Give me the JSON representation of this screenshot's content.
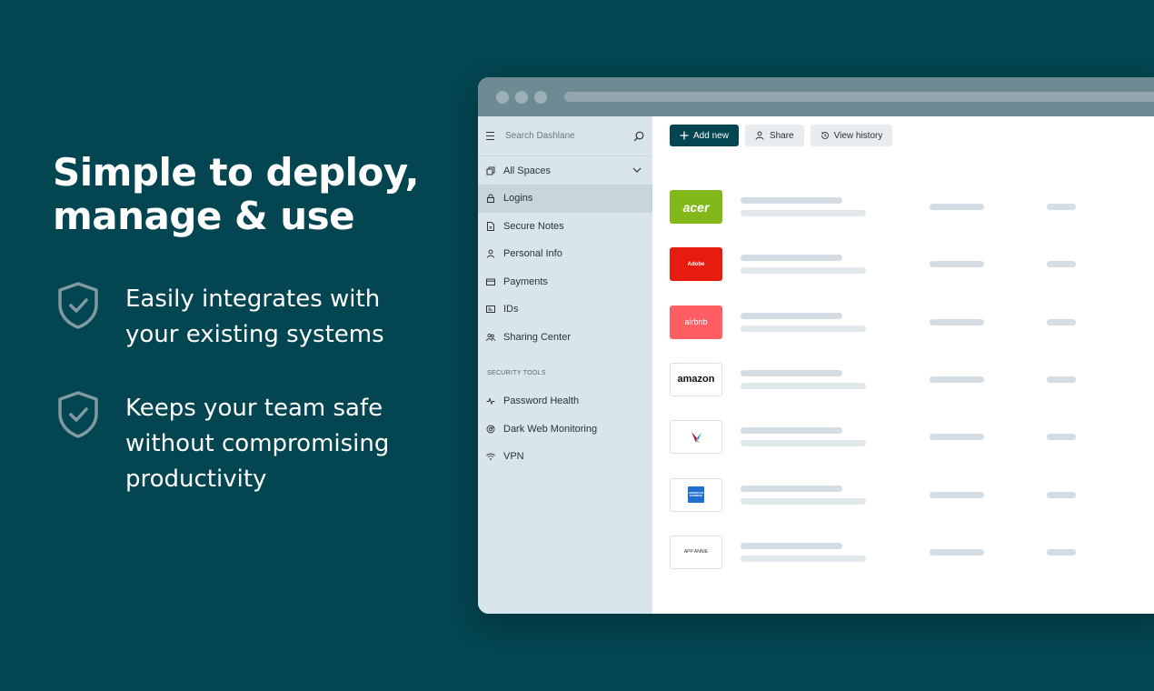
{
  "headline": "Simple to deploy, manage & use",
  "features": [
    {
      "text": "Easily integrates with your existing systems",
      "icon": "shield-check-icon"
    },
    {
      "text": "Keeps your team safe without compromising productivity",
      "icon": "shield-check-icon"
    }
  ],
  "app": {
    "search": {
      "placeholder": "Search Dashlane"
    },
    "spaces_label": "All Spaces",
    "nav": [
      {
        "label": "Logins",
        "icon": "lock-icon",
        "active": true
      },
      {
        "label": "Secure Notes",
        "icon": "note-icon"
      },
      {
        "label": "Personal Info",
        "icon": "person-icon"
      },
      {
        "label": "Payments",
        "icon": "card-icon"
      },
      {
        "label": "IDs",
        "icon": "id-icon"
      },
      {
        "label": "Sharing Center",
        "icon": "people-icon"
      }
    ],
    "security_tools_label": "SECURITY TOOLS",
    "tools": [
      {
        "label": "Password Health",
        "icon": "pulse-icon"
      },
      {
        "label": "Dark Web Monitoring",
        "icon": "radar-icon"
      },
      {
        "label": "VPN",
        "icon": "wifi-icon"
      }
    ],
    "toolbar": {
      "add_new": "Add new",
      "share": "Share",
      "view_history": "View history"
    },
    "logins": [
      {
        "brand": "acer",
        "logo_text": "acer",
        "bg": "#83b81a",
        "fg": "#ffffff"
      },
      {
        "brand": "adobe",
        "logo_text": "Adobe",
        "bg": "#e61c0f",
        "fg": "#ffffff"
      },
      {
        "brand": "airbnb",
        "logo_text": "airbnb",
        "bg": "#ff5f63",
        "fg": "#ffffff"
      },
      {
        "brand": "amazon",
        "logo_text": "amazon",
        "bg": "#ffffff",
        "fg": "#111111"
      },
      {
        "brand": "american-airlines",
        "logo_text": "",
        "bg": "#ffffff",
        "fg": "#111111"
      },
      {
        "brand": "american-express",
        "logo_text": "AMERICAN EXPRESS",
        "bg": "#ffffff",
        "fg": "#1f6fd0"
      },
      {
        "brand": "app-annie",
        "logo_text": "APP ANNIE",
        "bg": "#ffffff",
        "fg": "#333333"
      }
    ]
  }
}
